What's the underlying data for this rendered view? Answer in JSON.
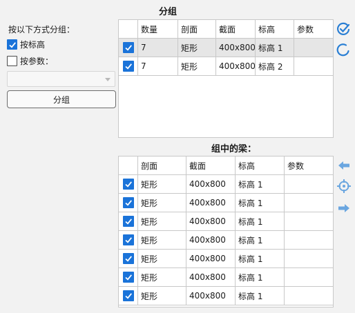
{
  "group_title": "分组",
  "left": {
    "mode_label": "按以下方式分组：",
    "by_elevation": {
      "label": "按标高",
      "checked": true
    },
    "by_param": {
      "label": "按参数：",
      "checked": false
    },
    "param_select_value": "",
    "group_button": "分组"
  },
  "groups_table": {
    "columns": [
      "",
      "数量",
      "剖面",
      "截面",
      "标高",
      "参数"
    ],
    "rows": [
      {
        "checked": true,
        "count": "7",
        "section": "矩形",
        "size": "400x800",
        "elevation": "标高 1",
        "param": ""
      },
      {
        "checked": true,
        "count": "7",
        "section": "矩形",
        "size": "400x800",
        "elevation": "标高 2",
        "param": ""
      }
    ]
  },
  "beams_title": "组中的梁：",
  "beams_table": {
    "columns": [
      "",
      "剖面",
      "截面",
      "标高",
      "参数"
    ],
    "rows": [
      {
        "checked": true,
        "section": "矩形",
        "size": "400x800",
        "elevation": "标高 1",
        "param": ""
      },
      {
        "checked": true,
        "section": "矩形",
        "size": "400x800",
        "elevation": "标高 1",
        "param": ""
      },
      {
        "checked": true,
        "section": "矩形",
        "size": "400x800",
        "elevation": "标高 1",
        "param": ""
      },
      {
        "checked": true,
        "section": "矩形",
        "size": "400x800",
        "elevation": "标高 1",
        "param": ""
      },
      {
        "checked": true,
        "section": "矩形",
        "size": "400x800",
        "elevation": "标高 1",
        "param": ""
      },
      {
        "checked": true,
        "section": "矩形",
        "size": "400x800",
        "elevation": "标高 1",
        "param": ""
      },
      {
        "checked": true,
        "section": "矩形",
        "size": "400x800",
        "elevation": "标高 1",
        "param": ""
      }
    ]
  },
  "side_icons": {
    "top": [
      "check-all-icon",
      "uncheck-all-icon"
    ],
    "bottom": [
      "arrow-left-icon",
      "crosshair-icon",
      "arrow-right-icon"
    ]
  },
  "colors": {
    "accent": "#1a73d9",
    "icon_blue": "#2a7fd4",
    "icon_light": "#6aa6e0"
  }
}
